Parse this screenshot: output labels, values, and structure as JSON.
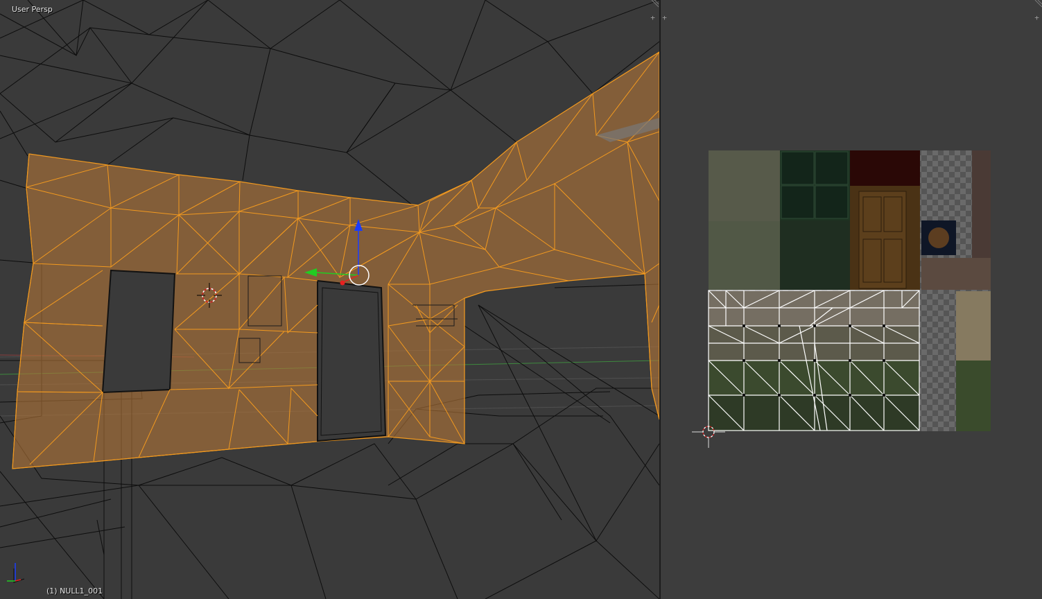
{
  "viewport3d": {
    "view_label": "User Persp",
    "object_label": "(1) NULL1_001",
    "mode": "edit-mesh-wireframe",
    "selection_color": "#f39a1f",
    "wire_color": "#000000",
    "background_color": "#3a3a3a"
  },
  "uv_editor": {
    "background_color": "#3d3d3d",
    "uv_wire_color": "#ffffff",
    "icons": [
      "2d-cursor-icon"
    ]
  },
  "corner_widgets": {
    "left_top": "+",
    "right_top": "+",
    "icons": [
      "area-split-icon"
    ]
  },
  "gizmo": {
    "icons": [
      "translate-gizmo-icon",
      "3d-cursor-icon",
      "axis-indicator-icon"
    ],
    "colors": {
      "x": "#e82020",
      "y": "#22cc22",
      "z": "#1a3cff"
    }
  }
}
